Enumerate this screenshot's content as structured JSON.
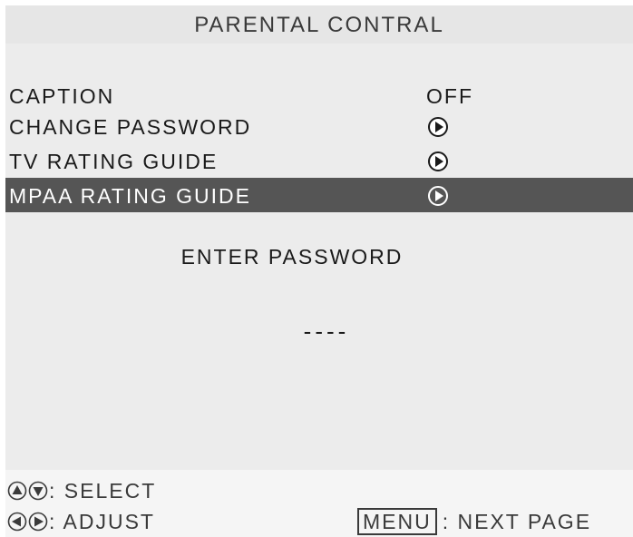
{
  "header": {
    "title": "PARENTAL CONTRAL"
  },
  "menu": {
    "items": [
      {
        "label": "CAPTION",
        "value": "OFF"
      },
      {
        "label": "CHANGE PASSWORD"
      },
      {
        "label": "TV RATING GUIDE"
      },
      {
        "label": "MPAA RATING GUIDE"
      }
    ]
  },
  "password": {
    "prompt": "ENTER PASSWORD",
    "value": "----"
  },
  "footer": {
    "select_hint": ": SELECT",
    "adjust_hint": ": ADJUST",
    "menu_key": "MENU",
    "next_page_hint": ": NEXT PAGE"
  }
}
